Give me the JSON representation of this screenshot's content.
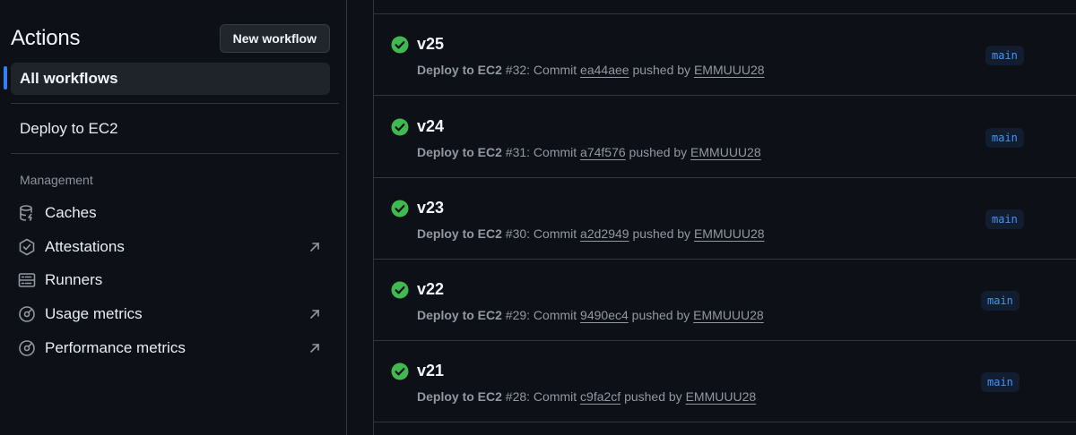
{
  "sidebar": {
    "title": "Actions",
    "new_workflow_label": "New workflow",
    "all_workflows_label": "All workflows",
    "workflows": [
      {
        "label": "Deploy to EC2"
      }
    ],
    "management_label": "Management",
    "management_items": [
      {
        "label": "Caches",
        "icon": "database-icon",
        "external": false
      },
      {
        "label": "Attestations",
        "icon": "attestation-badge-icon",
        "external": true
      },
      {
        "label": "Runners",
        "icon": "server-rack-icon",
        "external": false
      },
      {
        "label": "Usage metrics",
        "icon": "meter-icon",
        "external": true
      },
      {
        "label": "Performance metrics",
        "icon": "meter-icon",
        "external": true
      }
    ]
  },
  "runs": [
    {
      "title": "v25",
      "workflow": "Deploy to EC2",
      "number": "#32",
      "commit_prefix": ": Commit ",
      "commit": "ea44aee",
      "pushed_by_text": " pushed by ",
      "author": "EMMUUU28",
      "branch": "main",
      "status": "success"
    },
    {
      "title": "v24",
      "workflow": "Deploy to EC2",
      "number": "#31",
      "commit_prefix": ": Commit ",
      "commit": "a74f576",
      "pushed_by_text": " pushed by ",
      "author": "EMMUUU28",
      "branch": "main",
      "status": "success"
    },
    {
      "title": "v23",
      "workflow": "Deploy to EC2",
      "number": "#30",
      "commit_prefix": ": Commit ",
      "commit": "a2d2949",
      "pushed_by_text": " pushed by ",
      "author": "EMMUUU28",
      "branch": "main",
      "status": "success"
    },
    {
      "title": "v22",
      "workflow": "Deploy to EC2",
      "number": "#29",
      "commit_prefix": ": Commit ",
      "commit": "9490ec4",
      "pushed_by_text": " pushed by ",
      "author": "EMMUUU28",
      "branch": "main",
      "status": "success"
    },
    {
      "title": "v21",
      "workflow": "Deploy to EC2",
      "number": "#28",
      "commit_prefix": ": Commit ",
      "commit": "c9fa2cf",
      "pushed_by_text": " pushed by ",
      "author": "EMMUUU28",
      "branch": "main",
      "status": "success"
    }
  ],
  "colors": {
    "background": "#0d1117",
    "accent": "#2f81f7",
    "success": "#3fb950",
    "branch_text": "#4493f8",
    "muted_text": "#9198a1"
  }
}
